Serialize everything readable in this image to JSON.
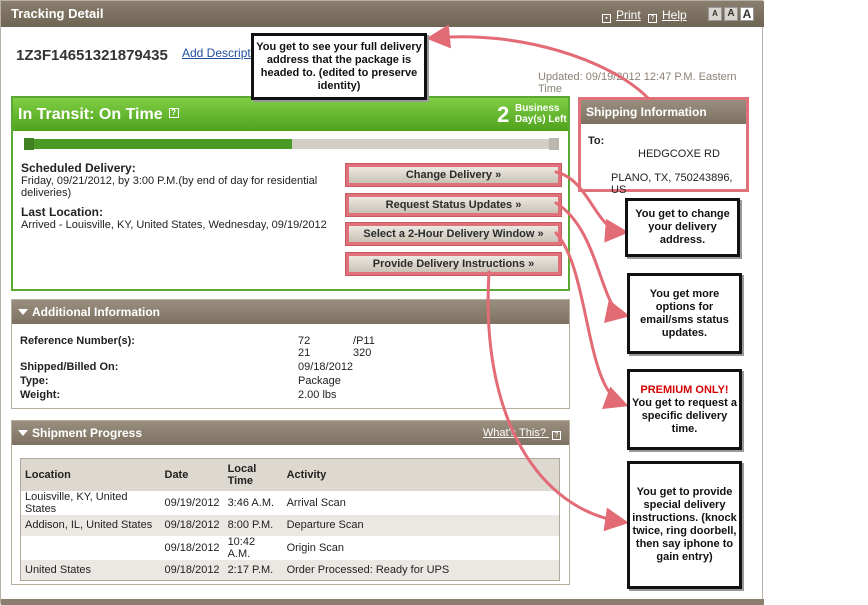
{
  "window": {
    "title": "Tracking Detail",
    "print_label": "Print",
    "help_label": "Help",
    "font_sizes": [
      "A",
      "A",
      "A"
    ]
  },
  "header": {
    "tracking_number": "1Z3F14651321879435",
    "add_description": "Add Description",
    "updated": "Updated: 09/19/2012 12:47 P.M. Eastern Time"
  },
  "status": {
    "title": "In Transit: On Time",
    "days_number": "2",
    "days_label_1": "Business",
    "days_label_2": "Day(s) Left",
    "progress_fraction": 0.5,
    "scheduled_label": "Scheduled Delivery:",
    "scheduled_line1": "Friday, 09/21/2012, by 3:00 P.M.(by end of day for residential",
    "scheduled_line2": "deliveries)",
    "last_location_label": "Last Location:",
    "last_location_value": "Arrived - Louisville, KY, United States, Wednesday, 09/19/2012",
    "buttons": [
      "Change Delivery »",
      "Request Status Updates »",
      "Select a 2-Hour Delivery Window »",
      "Provide Delivery Instructions »"
    ]
  },
  "additional": {
    "title": "Additional Information",
    "reference_label": "Reference Number(s):",
    "reference_line1": "72              /P11",
    "reference_line2": "21              320",
    "shipped_label": "Shipped/Billed On:",
    "shipped_value": "09/18/2012",
    "type_label": "Type:",
    "type_value": "Package",
    "weight_label": "Weight:",
    "weight_value": "2.00 lbs"
  },
  "progress": {
    "title": "Shipment Progress",
    "whats_this": "What's This?",
    "columns": [
      "Location",
      "Date",
      "Local Time",
      "Activity"
    ],
    "rows": [
      [
        "Louisville, KY, United States",
        "09/19/2012",
        "3:46 A.M.",
        "Arrival Scan"
      ],
      [
        "Addison, IL, United States",
        "09/18/2012",
        "8:00 P.M.",
        "Departure Scan"
      ],
      [
        "",
        "09/18/2012",
        "10:42 A.M.",
        "Origin Scan"
      ],
      [
        "United States",
        "09/18/2012",
        "2:17 P.M.",
        "Order Processed: Ready for UPS"
      ]
    ]
  },
  "shipping": {
    "title": "Shipping Information",
    "to_label": "To:",
    "street": "HEDGCOXE RD",
    "city": "PLANO, TX, 750243896, US"
  },
  "callouts": {
    "address": "You get to see your full delivery address that the package is headed to. (edited to preserve identity)",
    "change": "You get to change your delivery address.",
    "updates": "You get more options for email/sms status updates.",
    "premium": "PREMIUM ONLY!",
    "window": "You get to request a specific delivery time.",
    "instructions": "You get to provide special delivery instructions. (knock twice, ring doorbell, then say iphone to gain entry)"
  },
  "colors": {
    "status_green": "#5ca834",
    "header_brown": "#7d7262",
    "highlight_red": "#e0707a",
    "link_blue": "#1f4fa0"
  }
}
